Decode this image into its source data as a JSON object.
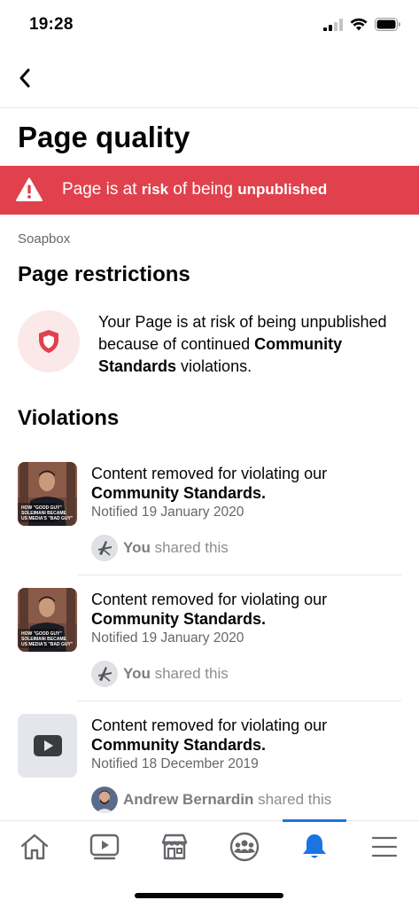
{
  "status_bar": {
    "time": "19:28",
    "signal_icon": "cellular-signal-icon",
    "wifi_icon": "wifi-icon",
    "battery_icon": "battery-icon"
  },
  "nav": {
    "back_icon": "chevron-left-icon"
  },
  "title": "Page quality",
  "alert": {
    "icon": "warning-triangle-icon",
    "prefix": "Page is at ",
    "bold1": "risk",
    "middle": " of being ",
    "bold2": "unpublished",
    "color": "#e0414c"
  },
  "page_name": "Soapbox",
  "restrictions": {
    "heading": "Page restrictions",
    "icon": "shield-icon",
    "text_before": "Your Page is at risk of being unpublished because of continued ",
    "text_bold": "Community Standards",
    "text_after": " violations."
  },
  "violations": {
    "heading": "Violations",
    "items": [
      {
        "line1": "Content removed for violating our",
        "line2": "Community Standards.",
        "date": "Notified 19 January 2020",
        "thumb_caption": "HOW \"GOOD GUY\" SOLEIMANI BECAME US MEDIA'S \"BAD GUY\"",
        "sharer": "You",
        "shared_suffix": " shared this"
      },
      {
        "line1": "Content removed for violating our",
        "line2": "Community Standards.",
        "date": "Notified 19 January 2020",
        "thumb_caption": "HOW \"GOOD GUY\" SOLEIMANI BECAME US MEDIA'S \"BAD GUY\"",
        "sharer": "You",
        "shared_suffix": " shared this"
      },
      {
        "line1": "Content removed for violating our",
        "line2": "Community Standards.",
        "date": "Notified 18 December 2019",
        "thumb_icon": "video-play-icon",
        "sharer": "Andrew Bernardin",
        "shared_suffix": " shared this"
      }
    ]
  },
  "tab_bar": {
    "tabs": [
      "home-icon",
      "watch-icon",
      "marketplace-icon",
      "groups-icon",
      "notifications-bell-icon",
      "menu-icon"
    ],
    "active_tab": "notifications-bell-icon",
    "active_color": "#1b74e4"
  }
}
